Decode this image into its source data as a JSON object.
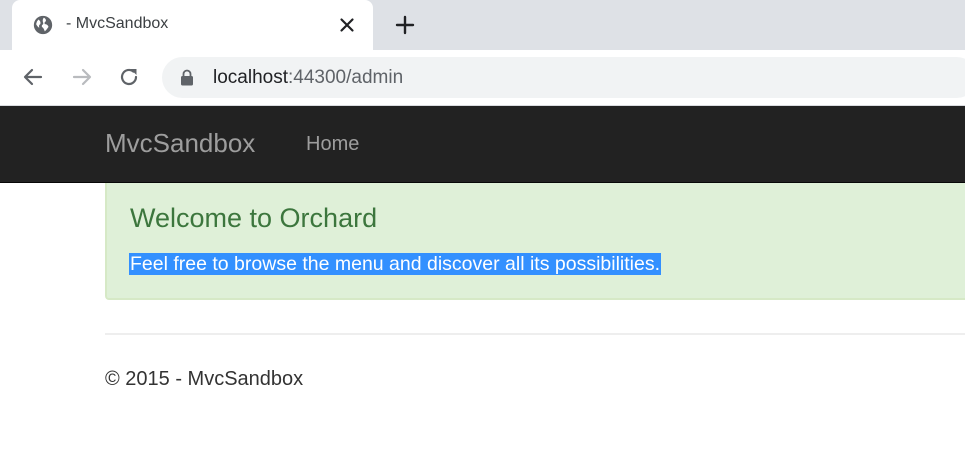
{
  "browser": {
    "tab_title": "- MvcSandbox",
    "url_host": "localhost",
    "url_rest": ":44300/admin",
    "icons": {
      "favicon": "globe-icon",
      "tab_close": "close-icon",
      "new_tab": "plus-icon",
      "back": "arrow-left-icon",
      "forward": "arrow-right-icon",
      "reload": "reload-icon",
      "secure": "lock-icon"
    }
  },
  "page": {
    "brand": "MvcSandbox",
    "nav": [
      {
        "label": "Home"
      }
    ],
    "alert": {
      "heading": "Welcome to Orchard",
      "text": "Feel free to browse the menu and discover all its possibilities."
    },
    "footer": "© 2015 - MvcSandbox"
  },
  "colors": {
    "navbar_bg": "#222222",
    "navbar_text": "#9d9d9d",
    "alert_bg": "#dff0d8",
    "alert_border": "#d6e9c6",
    "alert_heading": "#3c763d",
    "selection_bg": "#3390ff",
    "tabstrip_bg": "#dee1e6",
    "omnibox_bg": "#f1f3f4"
  }
}
